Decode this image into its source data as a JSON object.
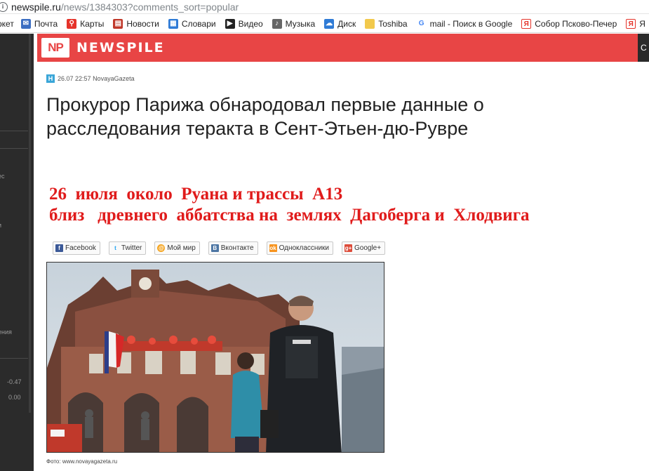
{
  "browser": {
    "url_host": "newspile.ru",
    "url_path": "/news/1384303?comments_sort=popular"
  },
  "bookmarks": [
    {
      "label": "ркет",
      "icon": "none",
      "color": "#ffffff"
    },
    {
      "label": "Почта",
      "icon": "mail-icon",
      "color": "#3b6ec2"
    },
    {
      "label": "Карты",
      "icon": "map-pin-icon",
      "color": "#e5332a"
    },
    {
      "label": "Новости",
      "icon": "news-icon",
      "color": "#c0392b"
    },
    {
      "label": "Словари",
      "icon": "dictionary-icon",
      "color": "#2f7bd6"
    },
    {
      "label": "Видео",
      "icon": "video-icon",
      "color": "#222222"
    },
    {
      "label": "Музыка",
      "icon": "music-icon",
      "color": "#666666"
    },
    {
      "label": "Диск",
      "icon": "disk-icon",
      "color": "#2f7bd6"
    },
    {
      "label": "Toshiba",
      "icon": "folder-icon",
      "color": "#f2c94c"
    },
    {
      "label": "mail - Поиск в Google",
      "icon": "google-icon",
      "color": "#4285f4"
    },
    {
      "label": "Собор Псково-Печер",
      "icon": "yandex-icon",
      "color": "#e5332a"
    },
    {
      "label": "Я",
      "icon": "yandex-icon",
      "color": "#e5332a"
    }
  ],
  "sidebar": {
    "texts": [
      "ес",
      "и",
      "ения",
      "-0.47",
      "0.00"
    ]
  },
  "header": {
    "logo": "NP",
    "brand": "NEWSPILE",
    "right_button": "C"
  },
  "article": {
    "date": "26.07 22:57",
    "source": "NovayaGazeta",
    "source_icon_letter": "H",
    "title": "Прокурор Парижа обнародовал первые данные о расследования теракта в Сент-Этьен-дю-Рувре",
    "red_line1": "26  июля  около  Руана и трассы  А13",
    "red_line2": "близ   древнего  аббатства на  землях  Дагоберга и  Хлодвига",
    "photo_credit_label": "Фото:",
    "photo_credit_value": "www.novayagazeta.ru"
  },
  "share": [
    {
      "label": "Facebook",
      "icon": "facebook-icon",
      "color": "#3b5998",
      "glyph": "f"
    },
    {
      "label": "Twitter",
      "icon": "twitter-icon",
      "color": "#1da1f2",
      "glyph": "t"
    },
    {
      "label": "Мой мир",
      "icon": "mymir-icon",
      "color": "#f5a623",
      "glyph": "@"
    },
    {
      "label": "Вконтакте",
      "icon": "vk-icon",
      "color": "#4c75a3",
      "glyph": "B"
    },
    {
      "label": "Одноклассники",
      "icon": "ok-icon",
      "color": "#f7931e",
      "glyph": "ok"
    },
    {
      "label": "Google+",
      "icon": "googleplus-icon",
      "color": "#dd4b39",
      "glyph": "g+"
    }
  ]
}
